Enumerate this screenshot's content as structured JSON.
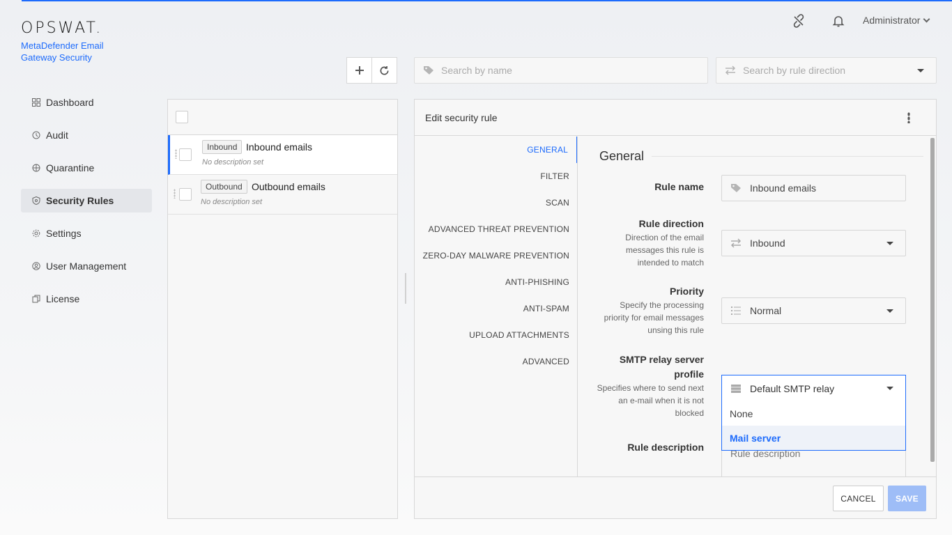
{
  "brand": {
    "logo": "OPSWAT.",
    "product": "MetaDefender Email Gateway Security"
  },
  "header": {
    "user": "Administrator"
  },
  "sidebar": {
    "items": [
      {
        "label": "Dashboard",
        "icon": "dashboard-icon"
      },
      {
        "label": "Audit",
        "icon": "audit-icon"
      },
      {
        "label": "Quarantine",
        "icon": "quarantine-icon"
      },
      {
        "label": "Security Rules",
        "icon": "shield-icon",
        "active": true
      },
      {
        "label": "Settings",
        "icon": "gear-icon"
      },
      {
        "label": "User Management",
        "icon": "user-icon"
      },
      {
        "label": "License",
        "icon": "license-icon"
      }
    ]
  },
  "toolbar": {
    "search_name_placeholder": "Search by name",
    "search_direction_placeholder": "Search by rule direction"
  },
  "rules": [
    {
      "tag": "Inbound",
      "name": "Inbound emails",
      "desc": "No description set",
      "active": true
    },
    {
      "tag": "Outbound",
      "name": "Outbound emails",
      "desc": "No description set",
      "active": false
    }
  ],
  "edit": {
    "title": "Edit security rule",
    "tabs": [
      "GENERAL",
      "FILTER",
      "SCAN",
      "ADVANCED THREAT PREVENTION",
      "ZERO-DAY MALWARE PREVENTION",
      "ANTI-PHISHING",
      "ANTI-SPAM",
      "UPLOAD ATTACHMENTS",
      "ADVANCED"
    ],
    "active_tab": "GENERAL",
    "section": "General",
    "fields": {
      "rule_name": {
        "label": "Rule name",
        "value": "Inbound emails"
      },
      "rule_direction": {
        "label": "Rule direction",
        "help": "Direction of the email messages this rule is intended to match",
        "value": "Inbound"
      },
      "priority": {
        "label": "Priority",
        "help": "Specify the processing priority for email messages unsing this rule",
        "value": "Normal"
      },
      "smtp": {
        "label": "SMTP relay server profile",
        "help": "Specifies where to send next an e-mail when it is not blocked",
        "value": "Default SMTP relay",
        "options": [
          "None",
          "Mail server"
        ],
        "highlighted": "Mail server"
      },
      "description": {
        "label": "Rule description",
        "placeholder": "Rule description"
      }
    },
    "cancel": "CANCEL",
    "save": "SAVE"
  },
  "colors": {
    "accent": "#1d6bfc",
    "save_disabled": "#9ebdf7"
  }
}
